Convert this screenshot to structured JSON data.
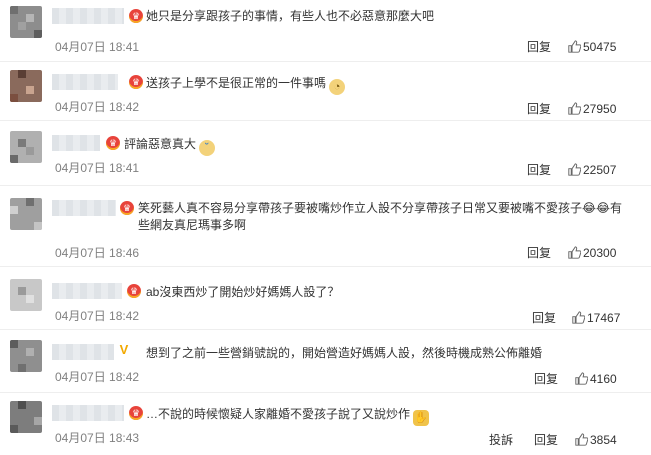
{
  "comments": [
    {
      "text": "她只是分享跟孩子的事情，有些人也不必惡意那麼大吧",
      "time": "04月07日 18:41",
      "reply_label": "回复",
      "likes": "50475",
      "badge_type": "crown",
      "emoji": ""
    },
    {
      "text": "送孩子上學不是很正常的一件事嗎",
      "time": "04月07日 18:42",
      "reply_label": "回复",
      "likes": "27950",
      "badge_type": "crown",
      "emoji": "doge-icon"
    },
    {
      "text": "評論惡意真大",
      "time": "04月07日 18:41",
      "reply_label": "回复",
      "likes": "22507",
      "badge_type": "crown",
      "emoji": "crying-icon"
    },
    {
      "text": "笑死藝人真不容易分享帶孩子要被嘴炒作立人設不分享帶孩子日常又要被嘴不愛孩子😂😂有些網友真尼瑪事多啊",
      "time": "04月07日 18:46",
      "reply_label": "回复",
      "likes": "20300",
      "badge_type": "crown",
      "emoji": ""
    },
    {
      "text": "ab沒東西炒了開始炒好媽媽人設了？",
      "time": "04月07日 18:42",
      "reply_label": "回复",
      "likes": "17467",
      "badge_type": "crown",
      "emoji": ""
    },
    {
      "text": "想到了之前一些營銷號說的，開始營造好媽媽人設，然後時機成熟公佈離婚",
      "time": "04月07日 18:42",
      "reply_label": "回复",
      "likes": "4160",
      "badge_type": "verified-v",
      "emoji": ""
    },
    {
      "text": "…不說的時候懷疑人家離婚不愛孩子說了又說炒作",
      "time": "04月07日 18:43",
      "report_label": "投訴",
      "reply_label": "回复",
      "likes": "3854",
      "badge_type": "crown",
      "emoji": "facepalm-icon"
    }
  ],
  "colors": {
    "text": "#333333",
    "meta": "#808080",
    "badge_red": "#e8433b",
    "badge_yellow": "#f2a900"
  }
}
